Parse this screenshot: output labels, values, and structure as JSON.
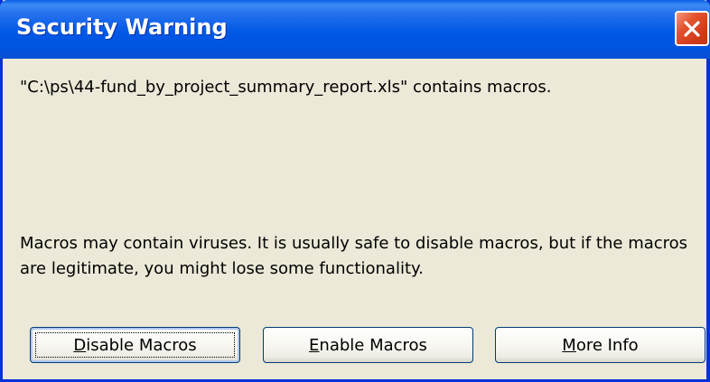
{
  "window": {
    "title": "Security Warning"
  },
  "message": {
    "file_text": "\"C:\\ps\\44-fund_by_project_summary_report.xls\" contains macros.",
    "warning": "Macros may contain viruses. It is usually safe to disable macros, but if the macros are legitimate, you might lose some functionality."
  },
  "buttons": {
    "disable": {
      "mnemonic": "D",
      "rest": "isable Macros"
    },
    "enable": {
      "mnemonic": "E",
      "rest": "nable Macros"
    },
    "more_info": {
      "prefix": "",
      "mnemonic": "M",
      "rest": "ore Info"
    }
  },
  "icons": {
    "close": "close-icon"
  },
  "colors": {
    "titlebar": "#0058e6",
    "close_button": "#d33c1b",
    "dialog_background": "#ece9d8",
    "button_border": "#003c74"
  }
}
